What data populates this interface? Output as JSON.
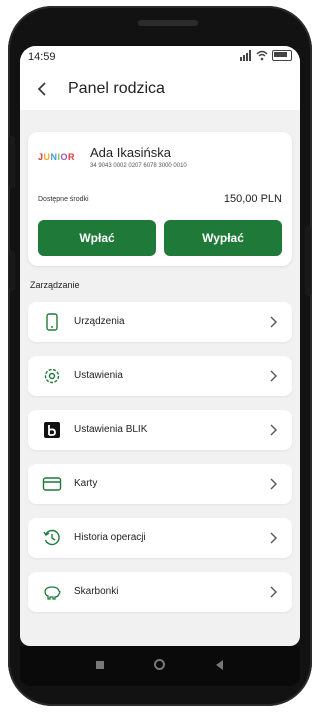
{
  "status": {
    "time": "14:59"
  },
  "header": {
    "title": "Panel rodzica",
    "back_icon": "chevron-left-icon"
  },
  "account": {
    "logo_text": "JUNIOR",
    "name": "Ada Ikasińska",
    "number": "34 9043 0002 0207 6078 3000 0010",
    "funds_label": "Dostępne środki",
    "funds_value": "150,00 PLN",
    "deposit_label": "Wpłać",
    "withdraw_label": "Wypłać"
  },
  "section": {
    "label": "Zarządzanie"
  },
  "menu": [
    {
      "label": "Urządzenia",
      "icon": "phone-icon"
    },
    {
      "label": "Ustawienia",
      "icon": "gear-icon"
    },
    {
      "label": "Ustawienia BLIK",
      "icon": "blik-icon"
    },
    {
      "label": "Karty",
      "icon": "card-icon"
    },
    {
      "label": "Historia operacji",
      "icon": "history-icon"
    },
    {
      "label": "Skarbonki",
      "icon": "piggy-bank-icon"
    }
  ],
  "colors": {
    "accent": "#1f7a3a",
    "background": "#f1f1f1"
  }
}
